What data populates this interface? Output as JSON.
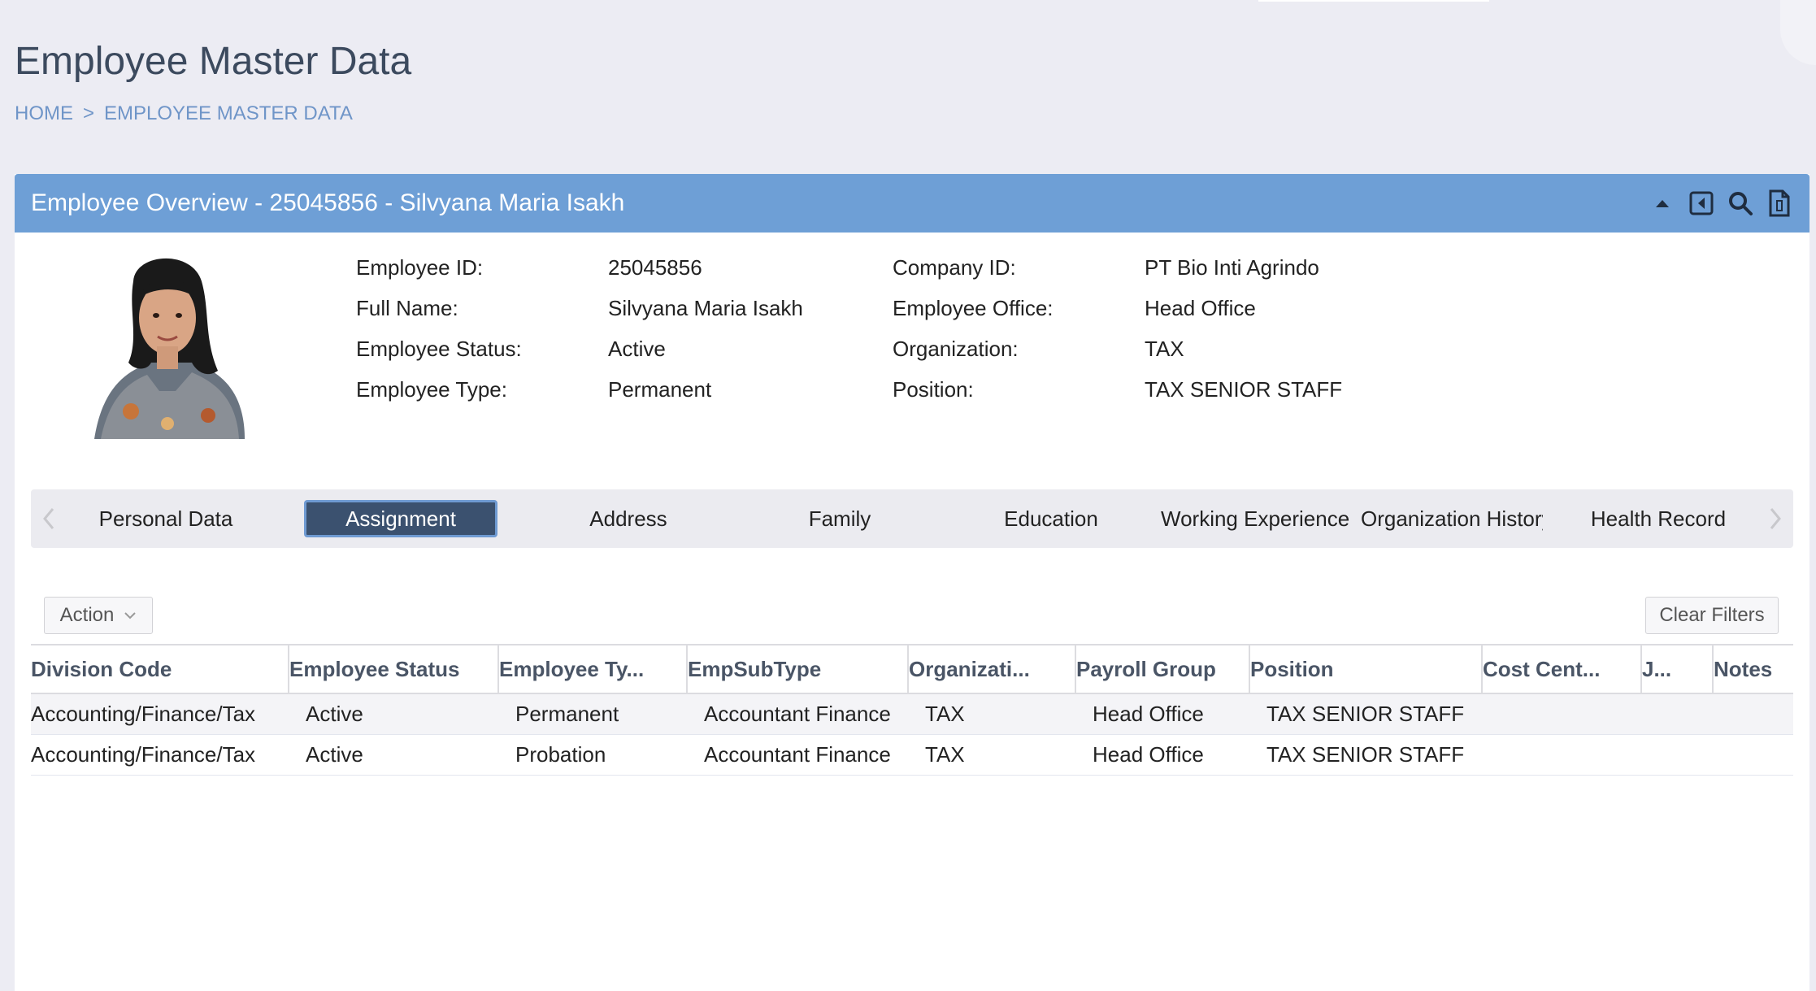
{
  "page": {
    "title": "Employee Master Data",
    "breadcrumb": [
      "HOME",
      ">",
      "EMPLOYEE MASTER DATA"
    ]
  },
  "panel": {
    "title": "Employee Overview - 25045856 - Silvyana Maria Isakh",
    "tools": [
      "collapse-up-icon",
      "back-icon",
      "search-icon",
      "document-icon"
    ]
  },
  "employee": {
    "labels": {
      "employee_id": "Employee ID:",
      "full_name": "Full Name:",
      "employee_status": "Employee Status:",
      "employee_type": "Employee Type:",
      "company_id": "Company ID:",
      "employee_office": "Employee Office:",
      "organization": "Organization:",
      "position": "Position:"
    },
    "values": {
      "employee_id": "25045856",
      "full_name": "Silvyana Maria Isakh",
      "employee_status": "Active",
      "employee_type": "Permanent",
      "company_id": "PT Bio Inti Agrindo",
      "employee_office": "Head Office",
      "organization": "TAX",
      "position": "TAX SENIOR STAFF"
    }
  },
  "tabs": [
    {
      "label": "Personal Data",
      "active": false
    },
    {
      "label": "Assignment",
      "active": true
    },
    {
      "label": "Address",
      "active": false
    },
    {
      "label": "Family",
      "active": false
    },
    {
      "label": "Education",
      "active": false
    },
    {
      "label": "Working Experience",
      "active": false
    },
    {
      "label": "Organization History",
      "active": false
    },
    {
      "label": "Health Record",
      "active": false
    }
  ],
  "toolbar": {
    "action_label": "Action",
    "clear_filters_label": "Clear Filters"
  },
  "table": {
    "columns": [
      "Division Code",
      "Employee Status",
      "Employee Ty...",
      "EmpSubType",
      "Organizati...",
      "Payroll Group",
      "Position",
      "Cost Cent...",
      "J...",
      "Notes"
    ],
    "rows": [
      [
        "Accounting/Finance/Tax",
        "Active",
        "Permanent",
        "Accountant Finance",
        "TAX",
        "Head Office",
        "TAX SENIOR STAFF",
        "",
        "",
        ""
      ],
      [
        "Accounting/Finance/Tax",
        "Active",
        "Probation",
        "Accountant Finance",
        "TAX",
        "Head Office",
        "TAX SENIOR STAFF",
        "",
        "",
        ""
      ]
    ]
  },
  "colors": {
    "header_blue": "#6e9fd6",
    "active_tab": "#3b516f",
    "breadcrumb": "#6f95c8"
  }
}
